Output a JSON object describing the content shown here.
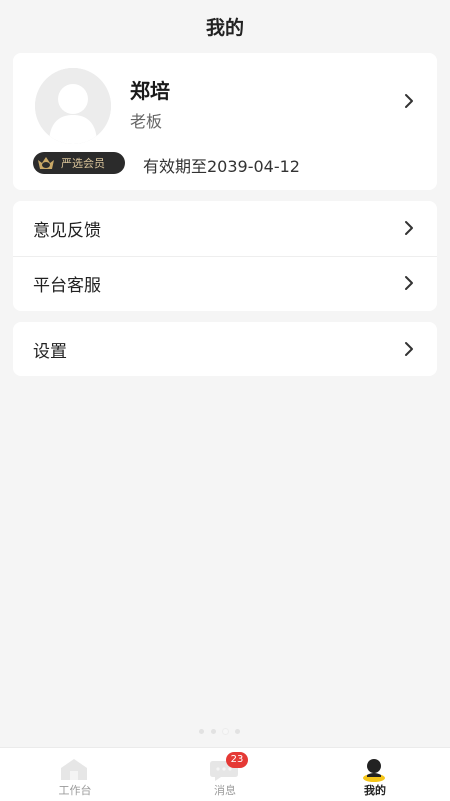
{
  "header": {
    "title": "我的"
  },
  "profile": {
    "name": "郑培",
    "role": "老板",
    "membership": {
      "badge_label": "严选会员",
      "validity": "有效期至2039-04-12"
    }
  },
  "menu": {
    "group1": [
      {
        "label": "意见反馈"
      },
      {
        "label": "平台客服"
      }
    ],
    "group2": [
      {
        "label": "设置"
      }
    ]
  },
  "tabbar": {
    "tabs": [
      {
        "label": "工作台",
        "icon": "home-icon"
      },
      {
        "label": "消息",
        "icon": "chat-icon",
        "badge": "23"
      },
      {
        "label": "我的",
        "icon": "user-icon"
      }
    ],
    "active": "我的"
  },
  "colors": {
    "badge_red": "#e53935",
    "member_gold": "#d9c39a",
    "member_dark": "#2b2b2b"
  },
  "pager": {
    "total": 4,
    "active": 3
  }
}
